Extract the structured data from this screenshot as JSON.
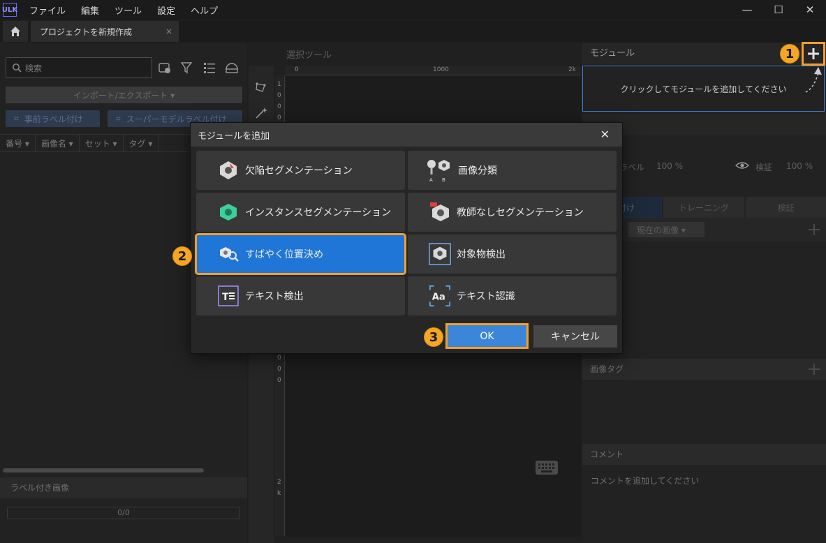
{
  "menubar": {
    "logo": "ULK",
    "items": [
      "ファイル",
      "編集",
      "ツール",
      "設定",
      "ヘルプ"
    ],
    "minimize": "—",
    "maximize": "☐",
    "close": "✕"
  },
  "tabs": {
    "home_icon": "home-icon",
    "project_tab": "プロジェクトを新規作成",
    "close": "×"
  },
  "left_panel": {
    "search_placeholder": "検索",
    "import_export": "インポート/エクスポート ▾",
    "pre_label": "事前ラベル付け",
    "super_model_label": "スーパーモデルラベル付け",
    "columns": [
      "番号 ▾",
      "画像名 ▾",
      "セット ▾",
      "タグ ▾"
    ],
    "labeled_images": "ラベル付き画像",
    "progress": "0/0"
  },
  "center": {
    "title": "選択ツール",
    "ruler_top": [
      "0",
      "1000",
      "2k"
    ],
    "ruler_left_top": [
      "1",
      "0",
      "0",
      "0"
    ],
    "ruler_left_mid": [
      "0",
      "0",
      "0"
    ],
    "ruler_left_bottom": [
      "2",
      "k"
    ]
  },
  "right_panel": {
    "module_title": "モジュール",
    "add_module_hint": "クリックしてモジュールを追加してください",
    "label_text": "ラベル",
    "label_pct": "100 %",
    "verify_text": "検証",
    "verify_pct": "100 %",
    "tabs": [
      "ル付け",
      "トレーニング",
      "検証"
    ],
    "current_image": "現在の画像 ▾",
    "image_tag": "画像タグ",
    "comment": "コメント",
    "comment_placeholder": "コメントを追加してください",
    "accent_color": "#f1a02a"
  },
  "dialog": {
    "title": "モジュールを追加",
    "close": "✕",
    "options": [
      {
        "label": "欠陥セグメンテーション",
        "icon": "defect-segmentation-icon"
      },
      {
        "label": "画像分類",
        "icon": "image-classification-icon"
      },
      {
        "label": "インスタンスセグメンテーション",
        "icon": "instance-segmentation-icon"
      },
      {
        "label": "教師なしセグメンテーション",
        "icon": "unsupervised-segmentation-icon"
      },
      {
        "label": "すばやく位置決め",
        "icon": "fast-positioning-icon",
        "selected": true
      },
      {
        "label": "対象物検出",
        "icon": "object-detection-icon"
      },
      {
        "label": "テキスト検出",
        "icon": "text-detection-icon"
      },
      {
        "label": "テキスト認識",
        "icon": "text-recognition-icon"
      }
    ],
    "ok": "OK",
    "cancel": "キャンセル"
  },
  "annotations": {
    "step1": "1",
    "step2": "2",
    "step3": "3"
  }
}
